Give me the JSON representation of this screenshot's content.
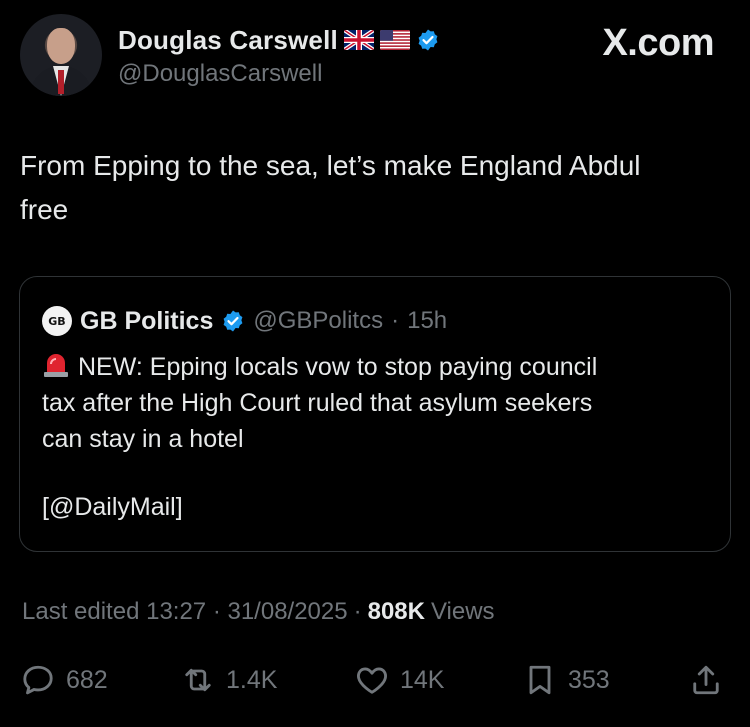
{
  "author": {
    "name": "Douglas Carswell",
    "handle": "@DouglasCarswell",
    "flags": [
      "uk-flag-emoji",
      "us-flag-emoji"
    ],
    "verified": true
  },
  "watermark": "X.com",
  "tweet": {
    "text_line1": "From Epping to the sea, let’s make England Abdul",
    "text_line2": "free"
  },
  "quote": {
    "name": "GB Politics",
    "handle": "@GBPolitcs",
    "separator": "·",
    "time": "15h",
    "logo_text": "GB",
    "body_line1": "NEW: Epping locals vow to stop paying council",
    "body_line2": "tax after the High Court ruled that asylum seekers",
    "body_line3": "can stay in a hotel",
    "source": "[@DailyMail]",
    "icon": "rotating-light-icon"
  },
  "meta": {
    "edited": "Last edited 13:27 · 31/08/2025",
    "dot": "·",
    "views_count": "808K",
    "views_label": "Views"
  },
  "actions": {
    "replies": "682",
    "reposts": "1.4K",
    "likes": "14K",
    "bookmarks": "353"
  },
  "colors": {
    "background": "#000000",
    "text": "#e7e9ea",
    "muted": "#71767b",
    "verified": "#1d9bf0",
    "border": "#2f3336"
  }
}
